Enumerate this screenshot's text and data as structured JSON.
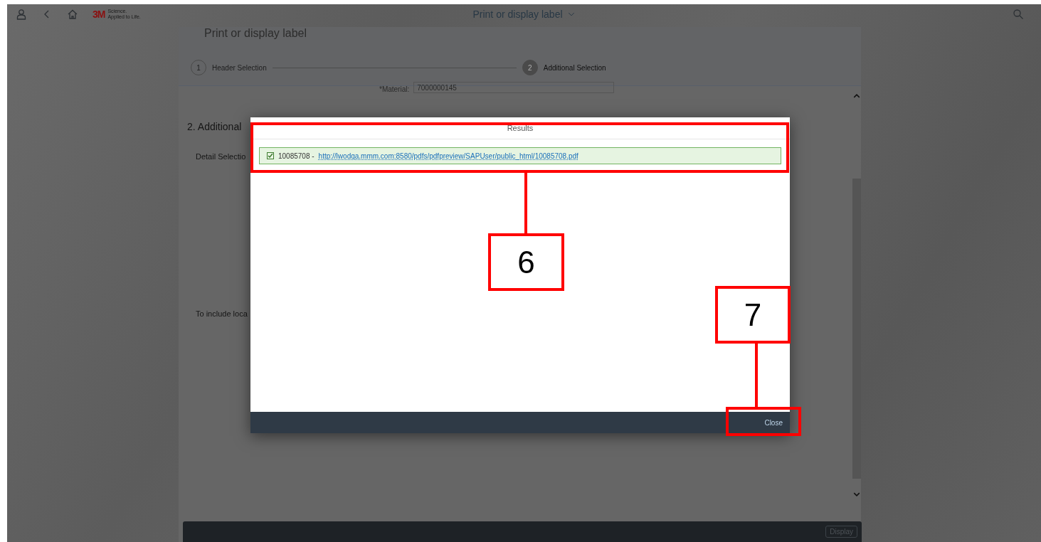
{
  "shell": {
    "title": "Print or display label",
    "logo_mark": "3M",
    "logo_tagline": [
      "Science.",
      "Applied to Life."
    ]
  },
  "page": {
    "title": "Print or display label",
    "steps": [
      {
        "number": "1",
        "label": "Header Selection",
        "selected": false
      },
      {
        "number": "2",
        "label": "Additional Selection",
        "selected": true
      }
    ],
    "material": {
      "label": "*Material:",
      "value": "7000000145"
    },
    "section_heading": "2. Additional",
    "texts": [
      "Detail Selectio",
      "To include loca"
    ],
    "footer_button": "Display"
  },
  "dialog": {
    "title": "Results",
    "messages": [
      {
        "checked": true,
        "number": "10085708 -",
        "link": "http://lwodqa.mmm.com:8580/pdfs/pdfpreview/SAPUser/public_html/10085708.pdf"
      }
    ],
    "close_button": "Close"
  },
  "callouts": [
    {
      "label": "6"
    },
    {
      "label": "7"
    }
  ]
}
